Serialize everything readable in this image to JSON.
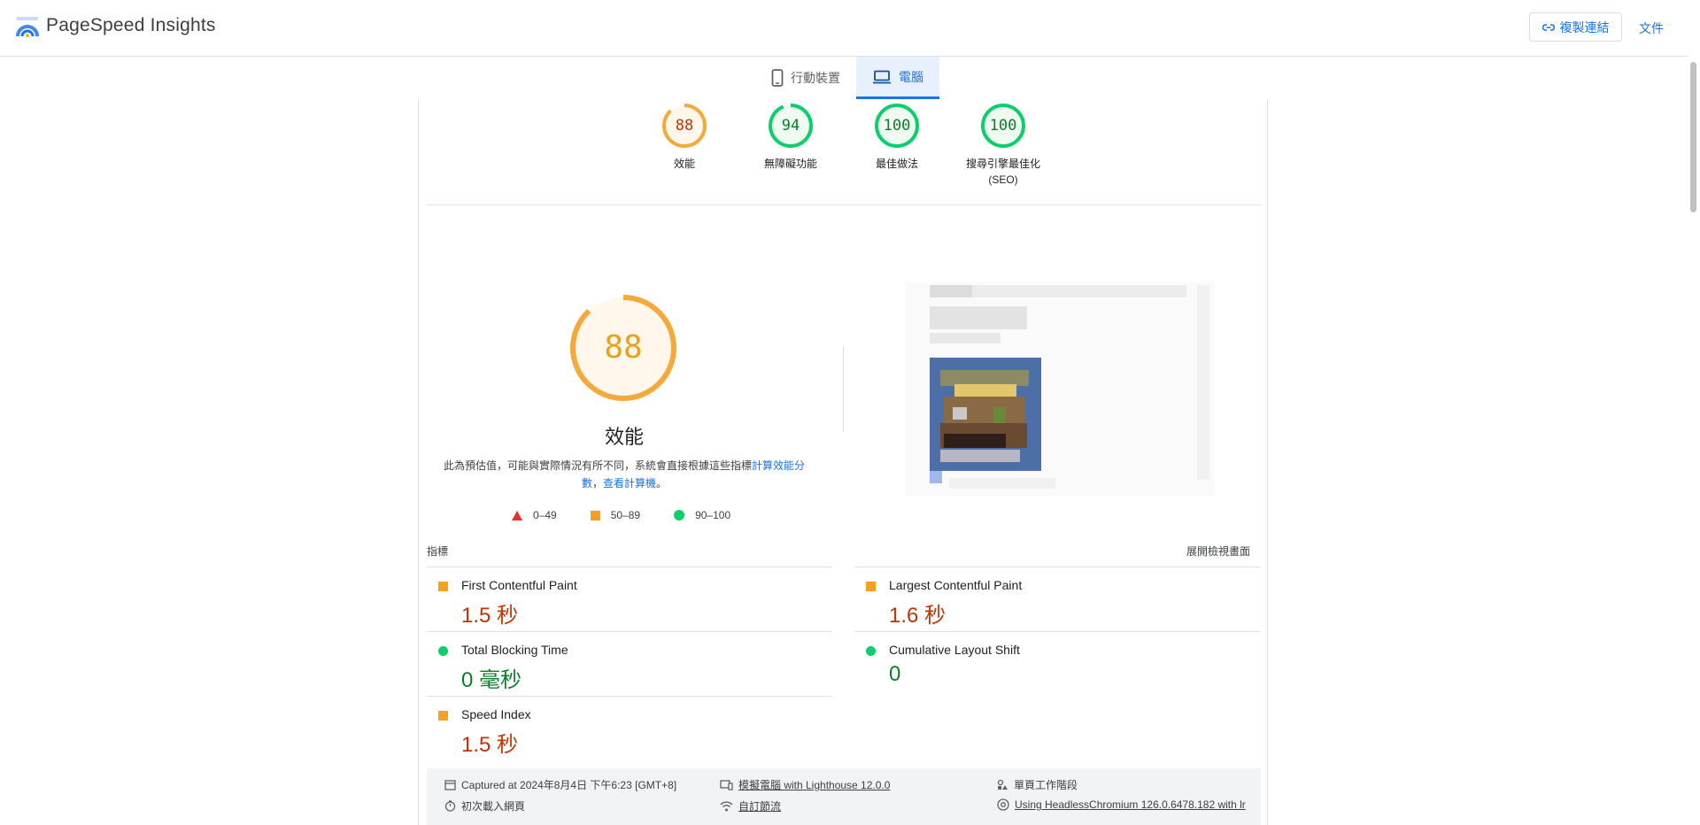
{
  "app": {
    "title": "PageSpeed Insights",
    "copy_link": "複製連結",
    "docs": "文件"
  },
  "tabs": [
    {
      "label": "行動裝置"
    },
    {
      "label": "電腦"
    }
  ],
  "scores": [
    {
      "value": "88",
      "label": "效能",
      "color": "#e8710a"
    },
    {
      "value": "94",
      "label": "無障礙功能",
      "color": "#0c7d2a"
    },
    {
      "value": "100",
      "label": "最佳做法",
      "color": "#0c7d2a"
    },
    {
      "value": "100",
      "label": "搜尋引擎最佳化",
      "label2": "(SEO)",
      "color": "#0c7d2a"
    }
  ],
  "performance": {
    "score": "88",
    "title": "效能",
    "desc_prefix": "此為預估值，可能與實際情況有所不同，系統會直接根據這些指標",
    "desc_link1": "計算效能分數",
    "desc_mid": "，",
    "desc_link2": "查看計算機",
    "desc_suffix": "。"
  },
  "legend": [
    {
      "range": "0–49"
    },
    {
      "range": "50–89"
    },
    {
      "range": "90–100"
    }
  ],
  "metrics_header": {
    "left": "指標",
    "right": "展開檢視畫面"
  },
  "metrics": [
    {
      "name": "First Contentful Paint",
      "value": "1.5 秒",
      "status": "average"
    },
    {
      "name": "Largest Contentful Paint",
      "value": "1.6 秒",
      "status": "average"
    },
    {
      "name": "Total Blocking Time",
      "value": "0 毫秒",
      "status": "pass"
    },
    {
      "name": "Cumulative Layout Shift",
      "value": "0",
      "status": "pass"
    },
    {
      "name": "Speed Index",
      "value": "1.5 秒",
      "status": "average"
    }
  ],
  "footer": {
    "captured": "Captured at 2024年8月4日 下午6:23 [GMT+8]",
    "emulated": "模擬電腦 with Lighthouse 12.0.0",
    "session": "單頁工作階段",
    "initial": "初次載入網頁",
    "throttling": "自訂節流",
    "browser": "Using HeadlessChromium 126.0.6478.182 with lr"
  }
}
